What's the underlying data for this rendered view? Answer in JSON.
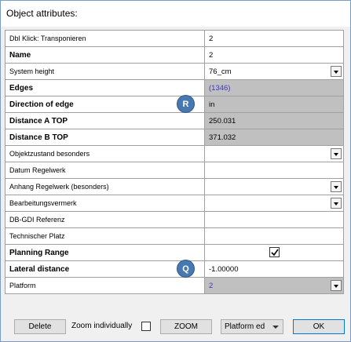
{
  "window": {
    "title": "Object attributes:"
  },
  "rows": [
    {
      "label": "Dbl Klick: Transponieren",
      "value": "2",
      "bold": false,
      "gray": false,
      "blue": false,
      "dropdown": false
    },
    {
      "label": "Name",
      "value": "2",
      "bold": true,
      "gray": false,
      "blue": false,
      "dropdown": false
    },
    {
      "label": "System height",
      "value": "76_cm",
      "bold": false,
      "gray": false,
      "blue": false,
      "dropdown": true
    },
    {
      "label": "Edges",
      "value": "(1346)",
      "bold": true,
      "gray": true,
      "blue": true,
      "dropdown": false
    },
    {
      "label": "Direction of edge",
      "value": "in",
      "bold": true,
      "gray": true,
      "blue": false,
      "dropdown": false,
      "badge": "R"
    },
    {
      "label": "Distance A TOP",
      "value": "250.031",
      "bold": true,
      "gray": true,
      "blue": false,
      "dropdown": false
    },
    {
      "label": "Distance B TOP",
      "value": "371.032",
      "bold": true,
      "gray": true,
      "blue": false,
      "dropdown": false
    },
    {
      "label": "Objektzustand besonders",
      "value": "",
      "bold": false,
      "gray": false,
      "blue": false,
      "dropdown": true
    },
    {
      "label": "Datum Regelwerk",
      "value": "",
      "bold": false,
      "gray": false,
      "blue": false,
      "dropdown": false
    },
    {
      "label": "Anhang Regelwerk (besonders)",
      "value": "",
      "bold": false,
      "gray": false,
      "blue": false,
      "dropdown": true
    },
    {
      "label": "Bearbeitungsvermerk",
      "value": "",
      "bold": false,
      "gray": false,
      "blue": false,
      "dropdown": true
    },
    {
      "label": "DB-GDI Referenz",
      "value": "",
      "bold": false,
      "gray": false,
      "blue": false,
      "dropdown": false
    },
    {
      "label": "Technischer Platz",
      "value": "",
      "bold": false,
      "gray": false,
      "blue": false,
      "dropdown": false
    },
    {
      "label": "Planning Range",
      "value": "",
      "bold": true,
      "gray": false,
      "blue": false,
      "dropdown": false,
      "checkbox": true,
      "checked": true
    },
    {
      "label": "Lateral distance",
      "value": "-1.00000",
      "bold": true,
      "gray": false,
      "blue": false,
      "dropdown": false,
      "badge": "Q"
    },
    {
      "label": "Platform",
      "value": "2",
      "bold": false,
      "gray": true,
      "blue": true,
      "dropdown": true
    }
  ],
  "footer": {
    "delete_label": "Delete",
    "zoom_individually_label": "Zoom individually",
    "zoom_individually_checked": false,
    "zoom_label": "ZOOM",
    "platform_combo_value": "Platform ed",
    "ok_label": "OK"
  }
}
